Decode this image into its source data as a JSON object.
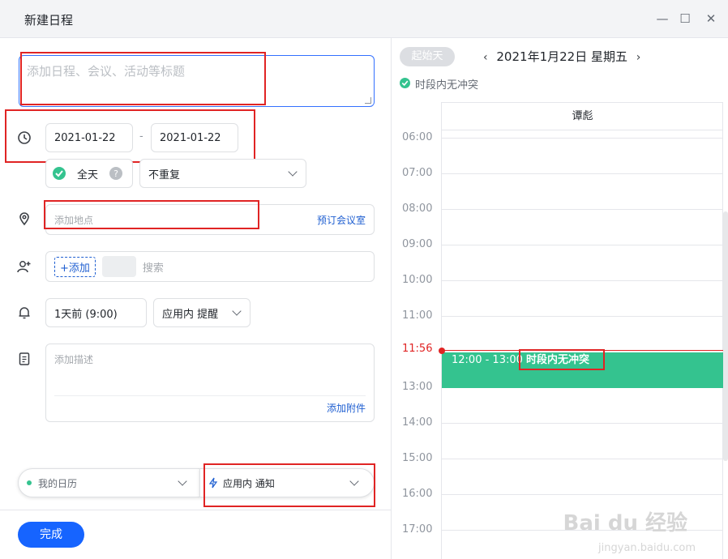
{
  "window": {
    "title": "新建日程",
    "minimize": "—",
    "maximize": "☐",
    "close": "✕"
  },
  "form": {
    "title_placeholder": "添加日程、会议、活动等标题",
    "start_date": "2021-01-22",
    "date_separator": "-",
    "end_date": "2021-01-22",
    "all_day_label": "全天",
    "repeat_value": "不重复",
    "location_placeholder": "添加地点",
    "book_room_link": "预订会议室",
    "add_attendee": "+添加",
    "search_placeholder": "搜索",
    "reminder_value": "1天前 (9:00)",
    "reminder_type": "应用内 提醒",
    "description_placeholder": "添加描述",
    "attachment_link": "添加附件",
    "calendar_name": "我的日历",
    "notify_value": "应用内 通知",
    "done_button": "完成"
  },
  "schedule": {
    "start_day_button": "起始天",
    "date_title": "2021年1月22日 星期五",
    "conflict_text": "时段内无冲突",
    "attendee_name": "谭彪",
    "hours": [
      "06:00",
      "07:00",
      "08:00",
      "09:00",
      "10:00",
      "11:00",
      "11:56",
      "13:00",
      "14:00",
      "15:00",
      "16:00",
      "17:00"
    ],
    "event_time": "12:00 - 13:00",
    "event_label": "时段内无冲突"
  },
  "watermark": {
    "brand": "Bai du 经验",
    "url": "jingyan.baidu.com"
  },
  "colors": {
    "accent": "#1664ff",
    "event": "#34c38f",
    "now": "#e02424",
    "highlight": "#e02424"
  }
}
